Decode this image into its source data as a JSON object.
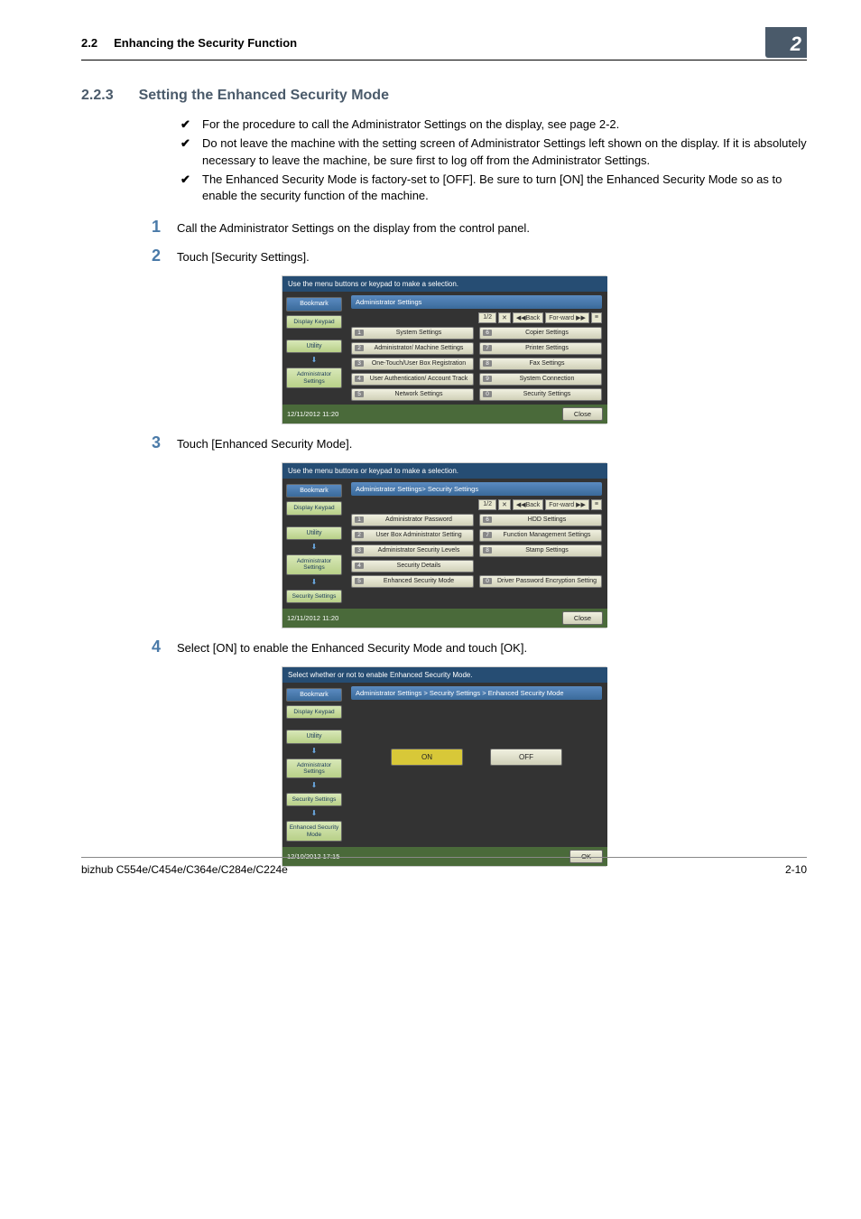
{
  "header": {
    "section_num": "2.2",
    "section_title": "Enhancing the Security Function",
    "chapter_badge": "2"
  },
  "heading": {
    "num": "2.2.3",
    "title": "Setting the Enhanced Security Mode"
  },
  "checks": [
    "For the procedure to call the Administrator Settings on the display, see page 2-2.",
    "Do not leave the machine with the setting screen of Administrator Settings left shown on the display. If it is absolutely necessary to leave the machine, be sure first to log off from the Administrator Settings.",
    "The Enhanced Security Mode is factory-set to [OFF]. Be sure to turn [ON] the Enhanced Security Mode so as to enable the security function of the machine."
  ],
  "steps": {
    "1": "Call the Administrator Settings on the display from the control panel.",
    "2": "Touch [Security Settings].",
    "3": "Touch [Enhanced Security Mode].",
    "4": "Select [ON] to enable the Enhanced Security Mode and touch [OK]."
  },
  "panel_common": {
    "top_instruction": "Use the menu buttons or keypad to make a selection.",
    "bookmark": "Bookmark",
    "display_keypad": "Display Keypad",
    "utility": "Utility",
    "admin": "Administrator Settings",
    "security": "Security Settings",
    "enhanced": "Enhanced Security Mode",
    "page": "1/2",
    "back": "◀◀Back",
    "forw": "For-ward ▶▶",
    "close": "Close",
    "ok": "OK"
  },
  "panel1": {
    "title": "Administrator Settings",
    "timestamp": "12/11/2012   11:20",
    "left": [
      {
        "n": "1",
        "l": "System Settings"
      },
      {
        "n": "2",
        "l": "Administrator/ Machine Settings"
      },
      {
        "n": "3",
        "l": "One-Touch/User Box Registration"
      },
      {
        "n": "4",
        "l": "User Authentication/ Account Track"
      },
      {
        "n": "5",
        "l": "Network Settings"
      }
    ],
    "right": [
      {
        "n": "6",
        "l": "Copier Settings"
      },
      {
        "n": "7",
        "l": "Printer Settings"
      },
      {
        "n": "8",
        "l": "Fax Settings"
      },
      {
        "n": "9",
        "l": "System Connection"
      },
      {
        "n": "0",
        "l": "Security Settings"
      }
    ]
  },
  "panel2": {
    "title": "Administrator Settings> Security Settings",
    "timestamp": "12/11/2012   11:20",
    "left": [
      {
        "n": "1",
        "l": "Administrator Password"
      },
      {
        "n": "2",
        "l": "User Box Administrator Setting"
      },
      {
        "n": "3",
        "l": "Administrator Security Levels"
      },
      {
        "n": "4",
        "l": "Security Details"
      },
      {
        "n": "5",
        "l": "Enhanced Security Mode"
      }
    ],
    "right": [
      {
        "n": "6",
        "l": "HDD Settings"
      },
      {
        "n": "7",
        "l": "Function Management Settings"
      },
      {
        "n": "8",
        "l": "Stamp Settings"
      },
      {
        "n": "",
        "l": ""
      },
      {
        "n": "0",
        "l": "Driver Password Encryption Setting"
      }
    ]
  },
  "panel3": {
    "top_instruction": "Select whether or not to enable Enhanced Security Mode.",
    "title": "Administrator Settings > Security Settings > Enhanced Security Mode",
    "timestamp": "12/10/2012   17:15",
    "on": "ON",
    "off": "OFF"
  },
  "footer": {
    "model": "bizhub C554e/C454e/C364e/C284e/C224e",
    "page": "2-10"
  }
}
